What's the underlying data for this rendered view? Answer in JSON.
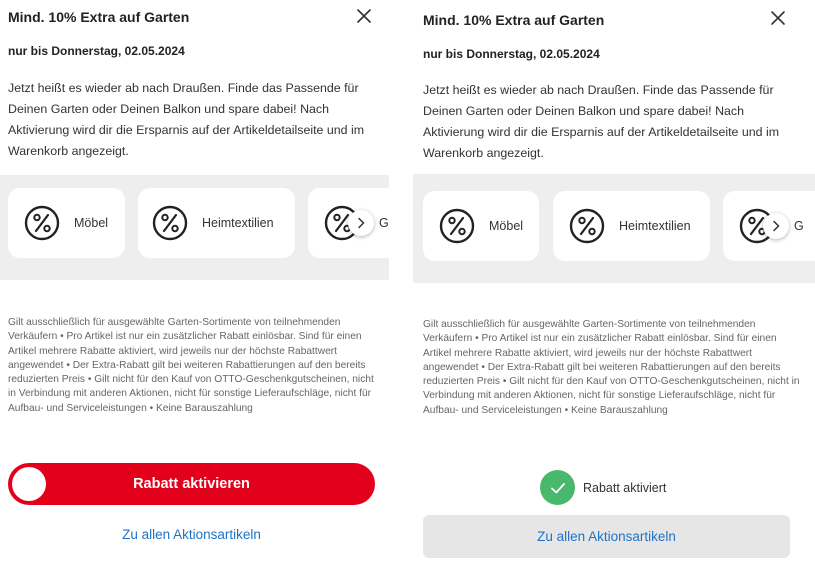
{
  "colors": {
    "brand_red": "#e3001b",
    "link_blue": "#1e73c8",
    "success_green": "#49b86c",
    "strip_background": "#eeeeee",
    "button_grey": "#e6e6e6"
  },
  "icons": {
    "close": "close-icon",
    "percent": "percent-icon",
    "chevron": "chevron-right-icon",
    "check": "check-icon"
  },
  "left": {
    "title": "Mind. 10% Extra auf Garten",
    "subtitle": "nur bis Donnerstag, 02.05.2024",
    "description": "Jetzt heißt es wieder ab nach Draußen. Finde das Passende für Deinen Garten oder Deinen Balkon und spare dabei! Nach Aktivierung wird dir die Ersparnis auf der Artikeldetailseite und im Warenkorb angezeigt.",
    "categories": [
      {
        "label": "Möbel"
      },
      {
        "label": "Heimtextilien"
      },
      {
        "label": "G"
      }
    ],
    "terms": "Gilt ausschließlich für ausgewählte Garten-Sortimente von teilnehmenden Verkäufern • Pro Artikel ist nur ein zusätzlicher Rabatt einlösbar. Sind für einen Artikel mehrere Rabatte aktiviert, wird jeweils nur der höchste Rabattwert angewendet • Der Extra-Rabatt gilt bei weiteren Rabattierungen auf den bereits reduzierten Preis • Gilt nicht für den Kauf von OTTO-Geschenkgutscheinen, nicht in Verbindung mit anderen Aktionen, nicht für sonstige Lieferaufschläge, nicht für Aufbau- und Serviceleistungen • Keine Barauszahlung",
    "activate_label": "Rabatt aktivieren",
    "all_items_link": "Zu allen Aktionsartikeln"
  },
  "right": {
    "title": "Mind. 10% Extra auf Garten",
    "subtitle": "nur bis Donnerstag, 02.05.2024",
    "description": "Jetzt heißt es wieder ab nach Draußen. Finde das Passende für Deinen Garten oder Deinen Balkon und spare dabei! Nach Aktivierung wird dir die Ersparnis auf der Artikeldetailseite und im Warenkorb angezeigt.",
    "categories": [
      {
        "label": "Möbel"
      },
      {
        "label": "Heimtextilien"
      },
      {
        "label": "G"
      }
    ],
    "terms": "Gilt ausschließlich für ausgewählte Garten-Sortimente von teilnehmenden Verkäufern • Pro Artikel ist nur ein zusätzlicher Rabatt einlösbar. Sind für einen Artikel mehrere Rabatte aktiviert, wird jeweils nur der höchste Rabattwert angewendet • Der Extra-Rabatt gilt bei weiteren Rabattierungen auf den bereits reduzierten Preis • Gilt nicht für den Kauf von OTTO-Geschenkgutscheinen, nicht in Verbindung mit anderen Aktionen, nicht für sonstige Lieferaufschläge, nicht für Aufbau- und Serviceleistungen • Keine Barauszahlung",
    "activated_label": "Rabatt aktiviert",
    "all_items_button": "Zu allen Aktionsartikeln"
  }
}
